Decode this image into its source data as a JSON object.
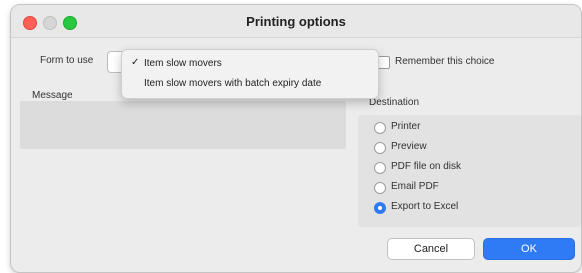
{
  "window": {
    "title": "Printing options"
  },
  "form": {
    "label": "Form to use",
    "options": [
      {
        "label": "Item slow movers",
        "checkmark": "✓"
      },
      {
        "label": "Item slow movers with batch expiry date",
        "checkmark": ""
      }
    ]
  },
  "remember": {
    "label": "Remember this choice",
    "checked": false
  },
  "message": {
    "label": "Message",
    "value": ""
  },
  "destination": {
    "label": "Destination",
    "options": [
      {
        "label": "Printer",
        "selected": false
      },
      {
        "label": "Preview",
        "selected": false
      },
      {
        "label": "PDF file on disk",
        "selected": false
      },
      {
        "label": "Email PDF",
        "selected": false
      },
      {
        "label": "Export to Excel",
        "selected": true
      }
    ]
  },
  "buttons": {
    "cancel": "Cancel",
    "ok": "OK"
  },
  "colors": {
    "accent": "#2f7bf5",
    "close": "#fe5f57",
    "zoom": "#28c840"
  }
}
